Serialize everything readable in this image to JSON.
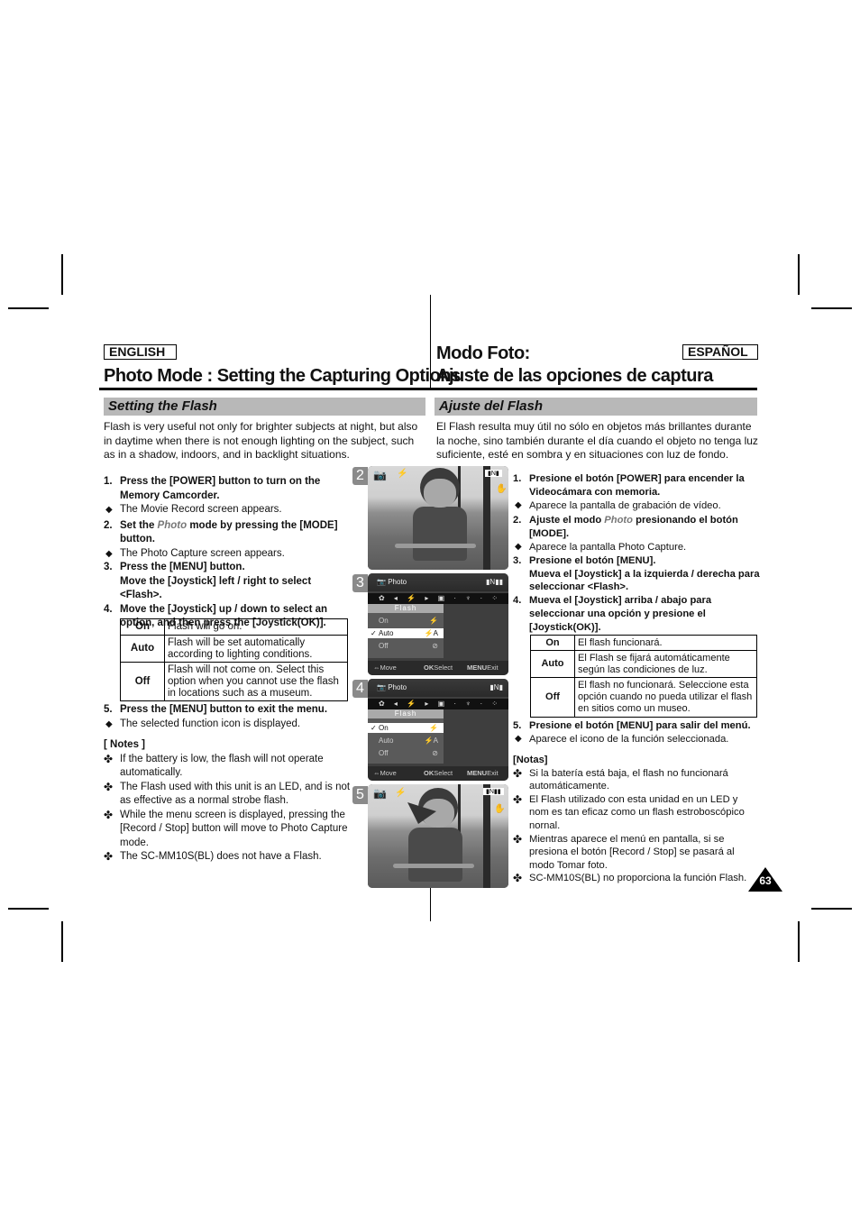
{
  "english": {
    "lang_label": "ENGLISH",
    "title": "Photo Mode : Setting the Capturing Options",
    "section": "Setting the Flash",
    "intro": "Flash is very useful not only for brighter subjects at night, but also in daytime when there is not enough lighting on the subject, such as in a shadow, indoors, and in backlight situations.",
    "steps": [
      {
        "num": "1.",
        "text": "Press the [POWER] button to turn on the Memory Camcorder.",
        "sub": "The Movie Record screen appears."
      },
      {
        "num": "2.",
        "pre": "Set the ",
        "em": "Photo",
        "post": " mode by pressing the [MODE] button.",
        "sub": "The Photo Capture screen appears."
      },
      {
        "num": "3.",
        "text": "Press the [MENU] button.",
        "text2": "Move the [Joystick] left / right to select <Flash>."
      },
      {
        "num": "4.",
        "text": "Move the [Joystick] up / down to select an option, and then press the [Joystick(OK)]."
      },
      {
        "num": "5.",
        "text": "Press the [MENU] button to exit the menu.",
        "sub": "The selected function icon is displayed."
      }
    ],
    "table": [
      {
        "key": "On",
        "desc": "Flash will go on."
      },
      {
        "key": "Auto",
        "desc": "Flash will be set automatically according to lighting conditions."
      },
      {
        "key": "Off",
        "desc": "Flash will not come on. Select this option when you cannot use the flash in locations such as a museum."
      }
    ],
    "notes_heading": "[ Notes ]",
    "notes": [
      "If the battery is low, the flash will not operate automatically.",
      "The Flash used with this unit is an LED, and is not as effective as a normal strobe flash.",
      "While the menu screen is displayed, pressing the [Record / Stop] button will move to Photo Capture mode.",
      "The SC-MM10S(BL) does not have a Flash."
    ]
  },
  "spanish": {
    "lang_label": "ESPAÑOL",
    "title_line1": "Modo Foto:",
    "title_line2": "Ajuste de las opciones de captura",
    "section": "Ajuste del Flash",
    "intro": "El Flash resulta muy útil no sólo en objetos más brillantes durante la noche, sino también durante el día cuando el objeto no tenga luz suficiente, esté en sombra y en situaciones con luz de fondo.",
    "steps": [
      {
        "num": "1.",
        "text": "Presione el botón [POWER] para encender la Videocámara con memoria.",
        "sub": "Aparece la pantalla de grabación de vídeo."
      },
      {
        "num": "2.",
        "pre": "Ajuste el modo ",
        "em": "Photo",
        "post": " presionando el botón [MODE].",
        "sub": "Aparece la pantalla Photo Capture."
      },
      {
        "num": "3.",
        "text": "Presione el botón [MENU].",
        "text2": "Mueva el [Joystick] a la izquierda / derecha para seleccionar <Flash>."
      },
      {
        "num": "4.",
        "text": "Mueva el [Joystick] arriba / abajo para seleccionar una opción y presione el [Joystick(OK)]."
      },
      {
        "num": "5.",
        "text": "Presione el botón [MENU] para salir del menú.",
        "sub": "Aparece el icono de la función seleccionada."
      }
    ],
    "table": [
      {
        "key": "On",
        "desc": "El flash funcionará."
      },
      {
        "key": "Auto",
        "desc": "El Flash se fijará automáticamente según las condiciones de luz."
      },
      {
        "key": "Off",
        "desc": "El flash no funcionará. Seleccione esta opción cuando no pueda utilizar el flash en sitios como un museo."
      }
    ],
    "notes_heading": "[Notas]",
    "notes": [
      "Si la batería está baja, el flash no funcionará automáticamente.",
      "El Flash utilizado con esta unidad en un LED y nom es tan eficaz como un flash estroboscópico nornal.",
      "Mientras aparece el menú en pantalla, si se presiona el botón [Record / Stop] se pasará al modo Tomar foto.",
      "SC-MM10S(BL) no proporciona la función Flash."
    ]
  },
  "screens": {
    "step_labels": [
      "2",
      "3",
      "4",
      "5"
    ],
    "menu": {
      "mode_label": "Photo",
      "flash_title": "Flash",
      "options": [
        "On",
        "Auto",
        "Off"
      ],
      "selected_step3": "Auto",
      "selected_step4": "On",
      "footer_move": "Move",
      "footer_ok_key": "OK",
      "footer_select": "Select",
      "footer_menu_key": "MENU",
      "footer_exit": "Exit"
    }
  },
  "page_number": "63"
}
